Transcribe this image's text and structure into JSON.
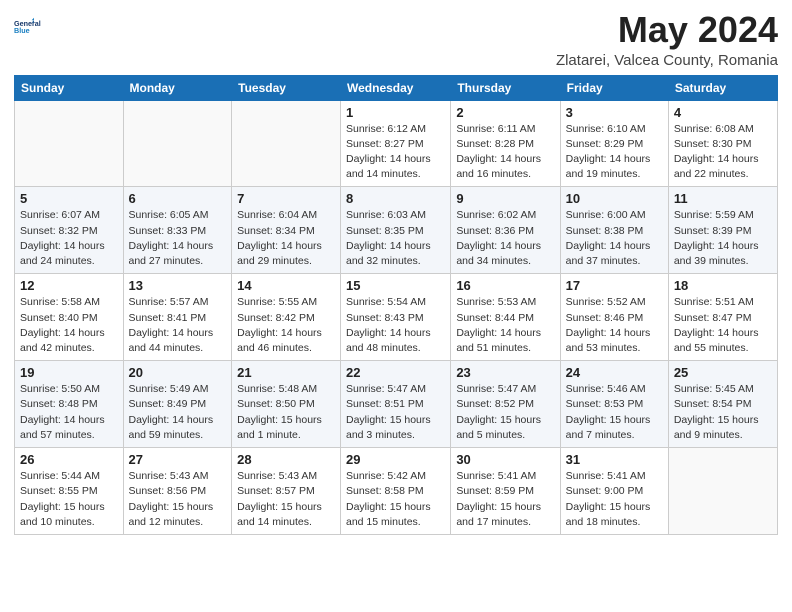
{
  "header": {
    "logo_line1": "General",
    "logo_line2": "Blue",
    "month": "May 2024",
    "location": "Zlatarei, Valcea County, Romania"
  },
  "weekdays": [
    "Sunday",
    "Monday",
    "Tuesday",
    "Wednesday",
    "Thursday",
    "Friday",
    "Saturday"
  ],
  "weeks": [
    [
      {
        "day": "",
        "info": ""
      },
      {
        "day": "",
        "info": ""
      },
      {
        "day": "",
        "info": ""
      },
      {
        "day": "1",
        "info": "Sunrise: 6:12 AM\nSunset: 8:27 PM\nDaylight: 14 hours and 14 minutes."
      },
      {
        "day": "2",
        "info": "Sunrise: 6:11 AM\nSunset: 8:28 PM\nDaylight: 14 hours and 16 minutes."
      },
      {
        "day": "3",
        "info": "Sunrise: 6:10 AM\nSunset: 8:29 PM\nDaylight: 14 hours and 19 minutes."
      },
      {
        "day": "4",
        "info": "Sunrise: 6:08 AM\nSunset: 8:30 PM\nDaylight: 14 hours and 22 minutes."
      }
    ],
    [
      {
        "day": "5",
        "info": "Sunrise: 6:07 AM\nSunset: 8:32 PM\nDaylight: 14 hours and 24 minutes."
      },
      {
        "day": "6",
        "info": "Sunrise: 6:05 AM\nSunset: 8:33 PM\nDaylight: 14 hours and 27 minutes."
      },
      {
        "day": "7",
        "info": "Sunrise: 6:04 AM\nSunset: 8:34 PM\nDaylight: 14 hours and 29 minutes."
      },
      {
        "day": "8",
        "info": "Sunrise: 6:03 AM\nSunset: 8:35 PM\nDaylight: 14 hours and 32 minutes."
      },
      {
        "day": "9",
        "info": "Sunrise: 6:02 AM\nSunset: 8:36 PM\nDaylight: 14 hours and 34 minutes."
      },
      {
        "day": "10",
        "info": "Sunrise: 6:00 AM\nSunset: 8:38 PM\nDaylight: 14 hours and 37 minutes."
      },
      {
        "day": "11",
        "info": "Sunrise: 5:59 AM\nSunset: 8:39 PM\nDaylight: 14 hours and 39 minutes."
      }
    ],
    [
      {
        "day": "12",
        "info": "Sunrise: 5:58 AM\nSunset: 8:40 PM\nDaylight: 14 hours and 42 minutes."
      },
      {
        "day": "13",
        "info": "Sunrise: 5:57 AM\nSunset: 8:41 PM\nDaylight: 14 hours and 44 minutes."
      },
      {
        "day": "14",
        "info": "Sunrise: 5:55 AM\nSunset: 8:42 PM\nDaylight: 14 hours and 46 minutes."
      },
      {
        "day": "15",
        "info": "Sunrise: 5:54 AM\nSunset: 8:43 PM\nDaylight: 14 hours and 48 minutes."
      },
      {
        "day": "16",
        "info": "Sunrise: 5:53 AM\nSunset: 8:44 PM\nDaylight: 14 hours and 51 minutes."
      },
      {
        "day": "17",
        "info": "Sunrise: 5:52 AM\nSunset: 8:46 PM\nDaylight: 14 hours and 53 minutes."
      },
      {
        "day": "18",
        "info": "Sunrise: 5:51 AM\nSunset: 8:47 PM\nDaylight: 14 hours and 55 minutes."
      }
    ],
    [
      {
        "day": "19",
        "info": "Sunrise: 5:50 AM\nSunset: 8:48 PM\nDaylight: 14 hours and 57 minutes."
      },
      {
        "day": "20",
        "info": "Sunrise: 5:49 AM\nSunset: 8:49 PM\nDaylight: 14 hours and 59 minutes."
      },
      {
        "day": "21",
        "info": "Sunrise: 5:48 AM\nSunset: 8:50 PM\nDaylight: 15 hours and 1 minute."
      },
      {
        "day": "22",
        "info": "Sunrise: 5:47 AM\nSunset: 8:51 PM\nDaylight: 15 hours and 3 minutes."
      },
      {
        "day": "23",
        "info": "Sunrise: 5:47 AM\nSunset: 8:52 PM\nDaylight: 15 hours and 5 minutes."
      },
      {
        "day": "24",
        "info": "Sunrise: 5:46 AM\nSunset: 8:53 PM\nDaylight: 15 hours and 7 minutes."
      },
      {
        "day": "25",
        "info": "Sunrise: 5:45 AM\nSunset: 8:54 PM\nDaylight: 15 hours and 9 minutes."
      }
    ],
    [
      {
        "day": "26",
        "info": "Sunrise: 5:44 AM\nSunset: 8:55 PM\nDaylight: 15 hours and 10 minutes."
      },
      {
        "day": "27",
        "info": "Sunrise: 5:43 AM\nSunset: 8:56 PM\nDaylight: 15 hours and 12 minutes."
      },
      {
        "day": "28",
        "info": "Sunrise: 5:43 AM\nSunset: 8:57 PM\nDaylight: 15 hours and 14 minutes."
      },
      {
        "day": "29",
        "info": "Sunrise: 5:42 AM\nSunset: 8:58 PM\nDaylight: 15 hours and 15 minutes."
      },
      {
        "day": "30",
        "info": "Sunrise: 5:41 AM\nSunset: 8:59 PM\nDaylight: 15 hours and 17 minutes."
      },
      {
        "day": "31",
        "info": "Sunrise: 5:41 AM\nSunset: 9:00 PM\nDaylight: 15 hours and 18 minutes."
      },
      {
        "day": "",
        "info": ""
      }
    ]
  ]
}
